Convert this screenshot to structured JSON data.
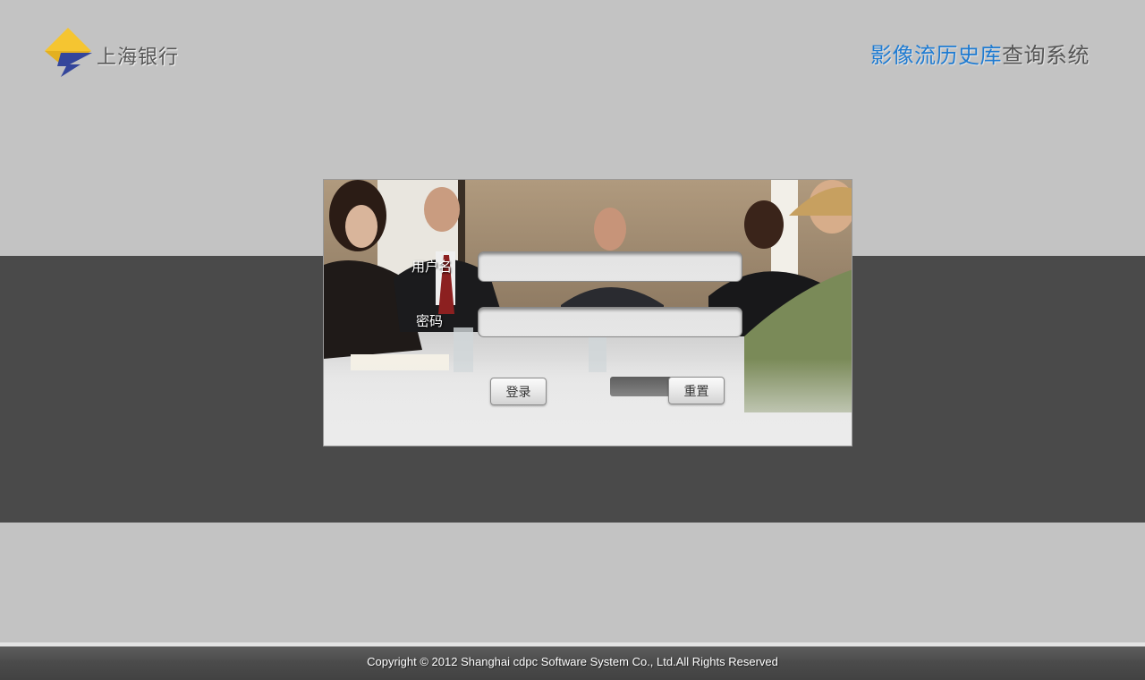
{
  "header": {
    "logo_text": "上海银行",
    "system_title_highlight": "影像流历史库",
    "system_title_rest": "查询系统"
  },
  "login": {
    "username_label": "用户名",
    "username_value": "",
    "password_label": "密码",
    "password_value": "",
    "login_button": "登录",
    "reset_button": "重置"
  },
  "footer": {
    "copyright": "Copyright  ©  2012 Shanghai cdpc Software System Co., Ltd.All Rights Reserved"
  },
  "colors": {
    "page_bg": "#c3c3c3",
    "band_bg": "#4a4a4a",
    "title_blue": "#1f7bd1",
    "title_gray": "#555555",
    "logo_yellow": "#f5c531",
    "logo_blue": "#34469b"
  },
  "icons": {
    "logo": "shanghai-bank-logo-icon",
    "photo": "business-meeting-photo"
  }
}
